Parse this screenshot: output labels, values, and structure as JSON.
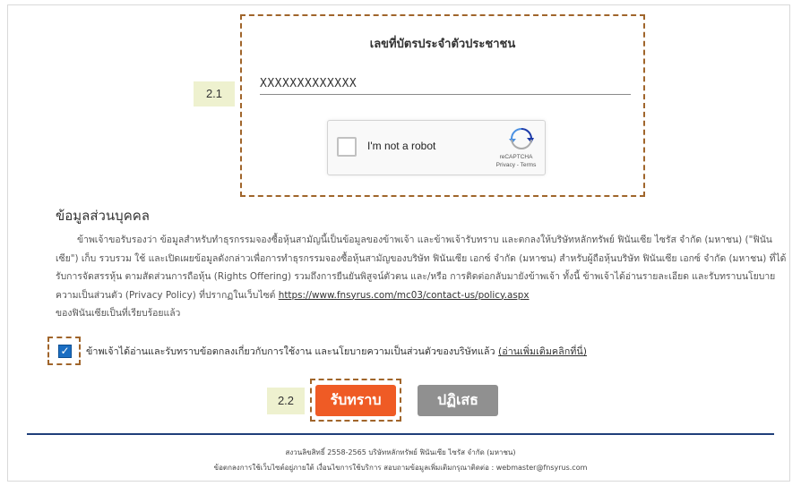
{
  "id_section": {
    "label": "เลขที่บัตรประจำตัวประชาชน",
    "value": "XXXXXXXXXXXXX"
  },
  "captcha": {
    "label": "I'm not a robot",
    "brand": "reCAPTCHA",
    "links": "Privacy - Terms"
  },
  "step_tags": {
    "step1": "2.1",
    "step2": "2.2"
  },
  "personal_info": {
    "title": "ข้อมูลส่วนบุคคล",
    "paragraph": "ข้าพเจ้าขอรับรองว่า ข้อมูลสำหรับทำธุรกรรมจองซื้อหุ้นสามัญนี้เป็นข้อมูลของข้าพเจ้า และข้าพเจ้ารับทราบ และตกลงให้บริษัทหลักทรัพย์ ฟินันเซีย ไซรัส จำกัด (มหาชน) (\"ฟินันเซีย\") เก็บ รวบรวม ใช้ และเปิดเผยข้อมูลดังกล่าวเพื่อการทำธุรกรรมจองซื้อหุ้นสามัญของบริษัท ฟินันเซีย เอกซ์ จำกัด (มหาชน) สำหรับผู้ถือหุ้นบริษัท ฟินันเซีย เอกซ์ จำกัด (มหาชน) ที่ได้รับการจัดสรรหุ้น ตามสัดส่วนการถือหุ้น (Rights Offering) รวมถึงการยืนยันพิสูจน์ตัวตน และ/หรือ การติดต่อกลับมายังข้าพเจ้า ทั้งนี้ ข้าพเจ้าได้อ่านรายละเอียด และรับทราบนโยบายความเป็นส่วนตัว (Privacy Policy) ที่ปรากฏในเว็บไซต์",
    "policy_url": "https://www.fnsyrus.com/mc03/contact-us/policy.aspx",
    "paragraph_end": "ของฟินันเซียเป็นที่เรียบร้อยแล้ว"
  },
  "consent": {
    "text": "ข้าพเจ้าได้อ่านและรับทราบข้อตกลงเกี่ยวกับการใช้งาน และนโยบายความเป็นส่วนตัวของบริษัทแล้ว",
    "link": "(อ่านเพิ่มเติมคลิกที่นี่)",
    "checked": true
  },
  "buttons": {
    "accept": "รับทราบ",
    "reject": "ปฏิเสธ"
  },
  "footer": {
    "copyright": "สงวนลิขสิทธิ์ 2558-2565 บริษัทหลักทรัพย์ ฟินันเซีย ไซรัส จำกัด (มหาชน)",
    "terms": "ข้อตกลงการใช้เว็บไซต์อยู่ภายใต้ เงื่อนไขการใช้บริการ สอบถามข้อมูลเพิ่มเติมกรุณาติดต่อ : webmaster@fnsyrus.com"
  },
  "colors": {
    "accept_button": "#ef5b25",
    "reject_button": "#909090",
    "highlight_border": "#a0652b",
    "step_tag_bg": "#eef1cf",
    "footer_line": "#1f3f7a"
  },
  "icons": {
    "captcha_logo": "recaptcha-logo-icon",
    "consent_check": "checkbox-checked-icon"
  }
}
